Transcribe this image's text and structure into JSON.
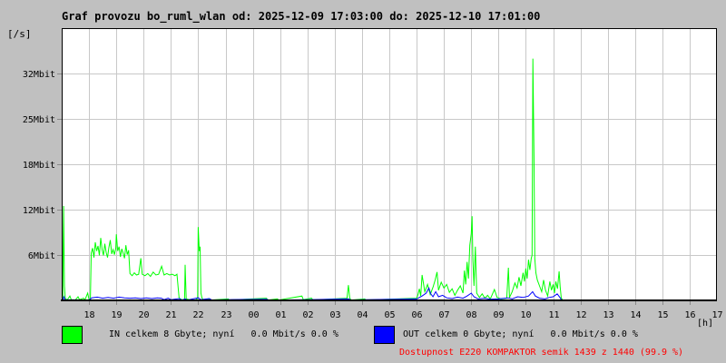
{
  "header": {
    "title": "Graf provozu bo_ruml_wlan od: 2025-12-09 17:03:00 do: 2025-12-10 17:01:00"
  },
  "axes": {
    "y_unit": "[/s]",
    "x_unit": "[h]"
  },
  "legend": {
    "in": {
      "label": "IN celkem 8 Gbyte; nyní   0.0 Mbit/s 0.0 %",
      "color": "#00ff00"
    },
    "out": {
      "label": "OUT celkem 0 Gbyte; nyní   0.0 Mbit/s 0.0 %",
      "color": "#0000ff"
    },
    "availability": {
      "text": "Dostupnost E220 KOMPAKTOR semik 1439 z 1440 (99.9 %)",
      "color": "#ff0000"
    }
  },
  "colors": {
    "page_background": "#c0c0c0",
    "plot_background": "#ffffff",
    "grid": "#c8c8c8",
    "border": "#000000",
    "in_line": "#00ff00",
    "out_line": "#0000ff",
    "availability_text": "#ff0000"
  },
  "chart_data": {
    "type": "line",
    "title": "Graf provozu bo_ruml_wlan od: 2025-12-09 17:03:00 do: 2025-12-10 17:01:00",
    "xlabel": "[h]",
    "ylabel": "[/s]",
    "grid": true,
    "x_axis": {
      "start_time": "17:00",
      "hours_span": 24,
      "tick_labels": [
        "18",
        "19",
        "20",
        "21",
        "22",
        "23",
        "00",
        "01",
        "02",
        "03",
        "04",
        "05",
        "06",
        "07",
        "08",
        "09",
        "10",
        "11",
        "12",
        "13",
        "14",
        "15",
        "16",
        "17"
      ]
    },
    "y_axis": {
      "max_mbit": 37.5,
      "ticks": [
        {
          "value": 6.25,
          "label": "6Mbit"
        },
        {
          "value": 12.5,
          "label": "12Mbit"
        },
        {
          "value": 18.75,
          "label": "18Mbit"
        },
        {
          "value": 25.0,
          "label": "25Mbit"
        },
        {
          "value": 31.25,
          "label": "32Mbit"
        }
      ]
    },
    "series": [
      {
        "name": "IN",
        "color": "#00ff00",
        "units": "Mbit/s, x = hours after 17:00",
        "points": [
          [
            0,
            0
          ],
          [
            0.04,
            0.2
          ],
          [
            0.07,
            13.0
          ],
          [
            0.1,
            2.0
          ],
          [
            0.13,
            0.3
          ],
          [
            0.2,
            0.05
          ],
          [
            0.3,
            0.6
          ],
          [
            0.35,
            0.1
          ],
          [
            0.5,
            0.05
          ],
          [
            0.6,
            0.5
          ],
          [
            0.65,
            0.1
          ],
          [
            0.8,
            0.3
          ],
          [
            0.85,
            0.05
          ],
          [
            0.95,
            1.0
          ],
          [
            1.0,
            0.15
          ],
          [
            1.05,
            0.1
          ],
          [
            1.08,
            6.5
          ],
          [
            1.13,
            7.2
          ],
          [
            1.18,
            5.9
          ],
          [
            1.23,
            8.0
          ],
          [
            1.28,
            6.8
          ],
          [
            1.33,
            7.5
          ],
          [
            1.38,
            6.2
          ],
          [
            1.43,
            8.6
          ],
          [
            1.48,
            7.0
          ],
          [
            1.53,
            6.2
          ],
          [
            1.58,
            7.8
          ],
          [
            1.63,
            6.6
          ],
          [
            1.68,
            5.9
          ],
          [
            1.73,
            7.3
          ],
          [
            1.78,
            8.3
          ],
          [
            1.83,
            6.4
          ],
          [
            1.88,
            7.0
          ],
          [
            1.93,
            6.3
          ],
          [
            1.98,
            7.2
          ],
          [
            2.0,
            9.1
          ],
          [
            2.05,
            6.8
          ],
          [
            2.1,
            7.4
          ],
          [
            2.15,
            6.0
          ],
          [
            2.2,
            7.1
          ],
          [
            2.25,
            6.5
          ],
          [
            2.3,
            5.8
          ],
          [
            2.35,
            7.6
          ],
          [
            2.4,
            6.3
          ],
          [
            2.45,
            6.9
          ],
          [
            2.5,
            3.7
          ],
          [
            2.58,
            3.4
          ],
          [
            2.66,
            3.8
          ],
          [
            2.74,
            3.5
          ],
          [
            2.82,
            3.6
          ],
          [
            2.9,
            5.8
          ],
          [
            2.95,
            3.6
          ],
          [
            3.05,
            3.4
          ],
          [
            3.15,
            3.7
          ],
          [
            3.25,
            3.3
          ],
          [
            3.35,
            3.9
          ],
          [
            3.45,
            3.5
          ],
          [
            3.55,
            3.6
          ],
          [
            3.66,
            4.7
          ],
          [
            3.75,
            3.5
          ],
          [
            3.85,
            3.7
          ],
          [
            3.95,
            3.5
          ],
          [
            4.05,
            3.6
          ],
          [
            4.15,
            3.4
          ],
          [
            4.22,
            3.6
          ],
          [
            4.27,
            1.5
          ],
          [
            4.3,
            0.3
          ],
          [
            4.4,
            0.1
          ],
          [
            4.5,
            0.1
          ],
          [
            4.52,
            4.9
          ],
          [
            4.56,
            0.2
          ],
          [
            4.7,
            0.1
          ],
          [
            4.9,
            0.05
          ],
          [
            4.98,
            0.3
          ],
          [
            5.0,
            10.1
          ],
          [
            5.04,
            6.8
          ],
          [
            5.07,
            7.4
          ],
          [
            5.1,
            1.0
          ],
          [
            5.14,
            0.3
          ],
          [
            5.2,
            0.05
          ],
          [
            5.4,
            0.2
          ],
          [
            5.45,
            0.05
          ],
          [
            6.1,
            0.2
          ],
          [
            6.15,
            0.05
          ],
          [
            7.5,
            0.3
          ],
          [
            7.55,
            0.05
          ],
          [
            7.9,
            0.2
          ],
          [
            7.95,
            0.05
          ],
          [
            8.8,
            0.6
          ],
          [
            8.85,
            0.1
          ],
          [
            9.15,
            0.3
          ],
          [
            9.2,
            0.05
          ],
          [
            10.45,
            0.3
          ],
          [
            10.5,
            2.1
          ],
          [
            10.55,
            0.3
          ],
          [
            10.6,
            0.05
          ],
          [
            11.1,
            0.2
          ],
          [
            11.15,
            0.05
          ],
          [
            13.0,
            0.3
          ],
          [
            13.05,
            0.8
          ],
          [
            13.1,
            1.6
          ],
          [
            13.15,
            0.6
          ],
          [
            13.2,
            3.5
          ],
          [
            13.3,
            1.2
          ],
          [
            13.4,
            2.2
          ],
          [
            13.5,
            0.8
          ],
          [
            13.6,
            1.8
          ],
          [
            13.68,
            2.8
          ],
          [
            13.75,
            3.9
          ],
          [
            13.8,
            1.4
          ],
          [
            13.9,
            2.5
          ],
          [
            14.0,
            1.7
          ],
          [
            14.1,
            2.2
          ],
          [
            14.2,
            1.1
          ],
          [
            14.3,
            1.6
          ],
          [
            14.4,
            0.7
          ],
          [
            14.5,
            1.4
          ],
          [
            14.6,
            2.0
          ],
          [
            14.7,
            1.0
          ],
          [
            14.75,
            4.1
          ],
          [
            14.8,
            2.2
          ],
          [
            14.85,
            5.3
          ],
          [
            14.9,
            3.0
          ],
          [
            14.95,
            7.6
          ],
          [
            15.0,
            9.2
          ],
          [
            15.03,
            11.6
          ],
          [
            15.06,
            5.5
          ],
          [
            15.1,
            2.0
          ],
          [
            15.15,
            7.4
          ],
          [
            15.2,
            1.0
          ],
          [
            15.3,
            0.4
          ],
          [
            15.4,
            0.9
          ],
          [
            15.5,
            0.3
          ],
          [
            15.6,
            0.7
          ],
          [
            15.7,
            0.2
          ],
          [
            15.85,
            1.5
          ],
          [
            15.95,
            0.4
          ],
          [
            16.1,
            0.2
          ],
          [
            16.3,
            0.3
          ],
          [
            16.36,
            4.5
          ],
          [
            16.4,
            0.4
          ],
          [
            16.5,
            1.2
          ],
          [
            16.6,
            2.4
          ],
          [
            16.68,
            1.7
          ],
          [
            16.75,
            3.2
          ],
          [
            16.82,
            2.0
          ],
          [
            16.9,
            3.8
          ],
          [
            16.95,
            2.6
          ],
          [
            17.0,
            4.4
          ],
          [
            17.05,
            3.0
          ],
          [
            17.1,
            5.6
          ],
          [
            17.15,
            4.2
          ],
          [
            17.2,
            5.8
          ],
          [
            17.23,
            6.2
          ],
          [
            17.26,
            33.3
          ],
          [
            17.3,
            19.9
          ],
          [
            17.33,
            5.8
          ],
          [
            17.37,
            3.8
          ],
          [
            17.42,
            2.8
          ],
          [
            17.5,
            2.0
          ],
          [
            17.58,
            1.2
          ],
          [
            17.65,
            2.8
          ],
          [
            17.72,
            1.4
          ],
          [
            17.8,
            0.6
          ],
          [
            17.88,
            2.6
          ],
          [
            17.94,
            1.4
          ],
          [
            18.0,
            2.2
          ],
          [
            18.05,
            1.0
          ],
          [
            18.1,
            2.6
          ],
          [
            18.16,
            1.6
          ],
          [
            18.22,
            4.0
          ],
          [
            18.26,
            1.8
          ],
          [
            18.3,
            0.3
          ],
          [
            18.35,
            0.05
          ],
          [
            24,
            0
          ]
        ]
      },
      {
        "name": "OUT",
        "color": "#0000ff",
        "units": "Mbit/s, x = hours after 17:00",
        "points": [
          [
            0,
            0
          ],
          [
            0.05,
            0.1
          ],
          [
            0.08,
            0.5
          ],
          [
            0.12,
            0.1
          ],
          [
            1.0,
            0.05
          ],
          [
            1.1,
            0.35
          ],
          [
            1.3,
            0.45
          ],
          [
            1.5,
            0.3
          ],
          [
            1.7,
            0.4
          ],
          [
            1.9,
            0.3
          ],
          [
            2.1,
            0.45
          ],
          [
            2.3,
            0.35
          ],
          [
            2.5,
            0.3
          ],
          [
            2.7,
            0.35
          ],
          [
            2.9,
            0.25
          ],
          [
            3.1,
            0.35
          ],
          [
            3.3,
            0.25
          ],
          [
            3.5,
            0.35
          ],
          [
            3.65,
            0.3
          ],
          [
            3.75,
            0.1
          ],
          [
            3.9,
            0.3
          ],
          [
            4.0,
            0.1
          ],
          [
            4.3,
            0.25
          ],
          [
            4.4,
            0.05
          ],
          [
            4.52,
            0.2
          ],
          [
            4.6,
            0.05
          ],
          [
            5.0,
            0.35
          ],
          [
            5.1,
            0.1
          ],
          [
            5.4,
            0.25
          ],
          [
            5.5,
            0.05
          ],
          [
            6.1,
            0.1
          ],
          [
            7.5,
            0.15
          ],
          [
            7.6,
            0.05
          ],
          [
            9.0,
            0.1
          ],
          [
            10.5,
            0.2
          ],
          [
            10.6,
            0.05
          ],
          [
            11.1,
            0.1
          ],
          [
            13.0,
            0.2
          ],
          [
            13.1,
            0.4
          ],
          [
            13.2,
            0.6
          ],
          [
            13.35,
            1.0
          ],
          [
            13.45,
            1.7
          ],
          [
            13.52,
            0.9
          ],
          [
            13.6,
            0.5
          ],
          [
            13.7,
            1.2
          ],
          [
            13.8,
            0.5
          ],
          [
            13.95,
            0.7
          ],
          [
            14.1,
            0.35
          ],
          [
            14.3,
            0.25
          ],
          [
            14.5,
            0.45
          ],
          [
            14.7,
            0.3
          ],
          [
            14.85,
            0.6
          ],
          [
            15.0,
            1.0
          ],
          [
            15.1,
            0.5
          ],
          [
            15.25,
            0.2
          ],
          [
            15.5,
            0.3
          ],
          [
            15.7,
            0.15
          ],
          [
            16.0,
            0.2
          ],
          [
            16.35,
            0.35
          ],
          [
            16.5,
            0.2
          ],
          [
            16.7,
            0.5
          ],
          [
            16.9,
            0.4
          ],
          [
            17.1,
            0.6
          ],
          [
            17.25,
            1.2
          ],
          [
            17.35,
            0.6
          ],
          [
            17.5,
            0.3
          ],
          [
            17.7,
            0.2
          ],
          [
            17.85,
            0.4
          ],
          [
            18.0,
            0.5
          ],
          [
            18.15,
            0.9
          ],
          [
            18.25,
            0.4
          ],
          [
            18.3,
            0.1
          ],
          [
            18.35,
            0.02
          ],
          [
            24,
            0
          ]
        ]
      }
    ]
  }
}
